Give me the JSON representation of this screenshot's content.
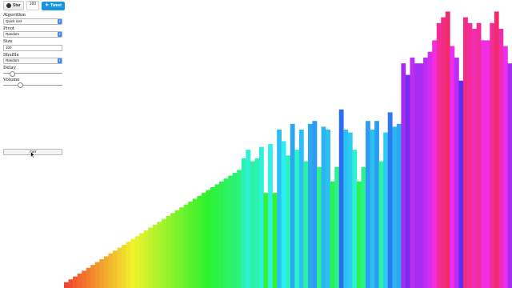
{
  "header": {
    "star_label": "Star",
    "star_count": "160",
    "tweet_label": "Tweet",
    "github_icon": "github-icon",
    "twitter_icon": "twitter-bird-icon"
  },
  "controls": {
    "algorithm": {
      "label": "Algorithm",
      "value": "Quick sort"
    },
    "pivot": {
      "label": "Pivot",
      "value": "Random"
    },
    "size": {
      "label": "Size",
      "value": "100"
    },
    "shuffle": {
      "label": "Shuffle",
      "value": "Random"
    },
    "delay": {
      "label": "Delay",
      "level": 0.12
    },
    "volume": {
      "label": "Volume",
      "level": 0.27
    },
    "sort_button": "Sort"
  },
  "chart_data": {
    "type": "bar",
    "description": "",
    "max_value": 100,
    "values": [
      2,
      3,
      4,
      5,
      6,
      7,
      8,
      9,
      10,
      11,
      12,
      13,
      14,
      15,
      16,
      17,
      18,
      19,
      20,
      21,
      22,
      23,
      24,
      25,
      26,
      27,
      28,
      29,
      30,
      31,
      32,
      33,
      34,
      35,
      36,
      37,
      38,
      39,
      40,
      41,
      45,
      48,
      44,
      45,
      49,
      33,
      50,
      33,
      55,
      51,
      46,
      57,
      48,
      55,
      44,
      57,
      58,
      42,
      56,
      55,
      37,
      42,
      62,
      55,
      54,
      48,
      37,
      42,
      58,
      55,
      58,
      44,
      54,
      61,
      56,
      57,
      78,
      74,
      80,
      78,
      78,
      80,
      82,
      86,
      92,
      94,
      96,
      84,
      80,
      72,
      94,
      92,
      90,
      92,
      86,
      86,
      92,
      96,
      90,
      84,
      78
    ]
  }
}
